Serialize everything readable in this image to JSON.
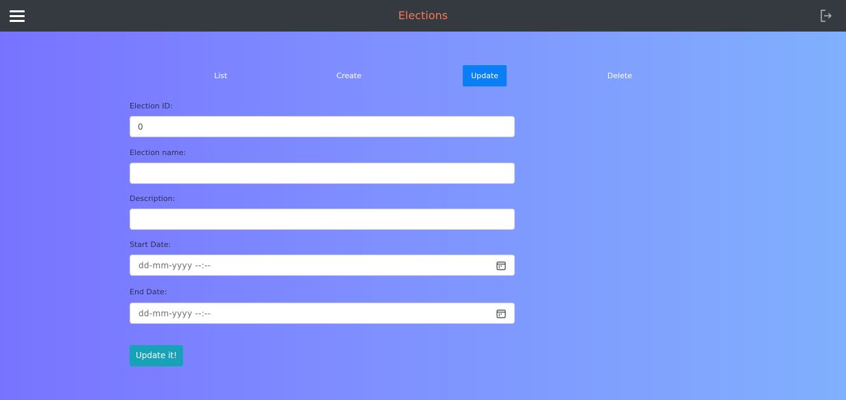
{
  "app": {
    "title": "Elections"
  },
  "header": {
    "menu_icon": "hamburger-menu-icon",
    "logout_icon": "logout-icon"
  },
  "tabs": [
    {
      "label": "List",
      "active": false
    },
    {
      "label": "Create",
      "active": false
    },
    {
      "label": "Update",
      "active": true
    },
    {
      "label": "Delete",
      "active": false
    }
  ],
  "form": {
    "election_id": {
      "label": "Election ID:",
      "value": "0"
    },
    "election_name": {
      "label": "Election name:",
      "value": ""
    },
    "description": {
      "label": "Description:",
      "value": ""
    },
    "start_date": {
      "label": "Start Date:",
      "placeholder": "dd-mm-yyyy --:--",
      "icon": "calendar-icon"
    },
    "end_date": {
      "label": "End Date:",
      "placeholder": "dd-mm-yyyy --:--",
      "icon": "calendar-icon"
    },
    "submit_label": "Update it!"
  },
  "colors": {
    "navbar": "#343a40",
    "title": "#f07a5a",
    "active_tab": "#0a7ef5",
    "submit_button": "#17a2b8",
    "gradient_start": "#7873ff",
    "gradient_end": "#80b0fe"
  }
}
